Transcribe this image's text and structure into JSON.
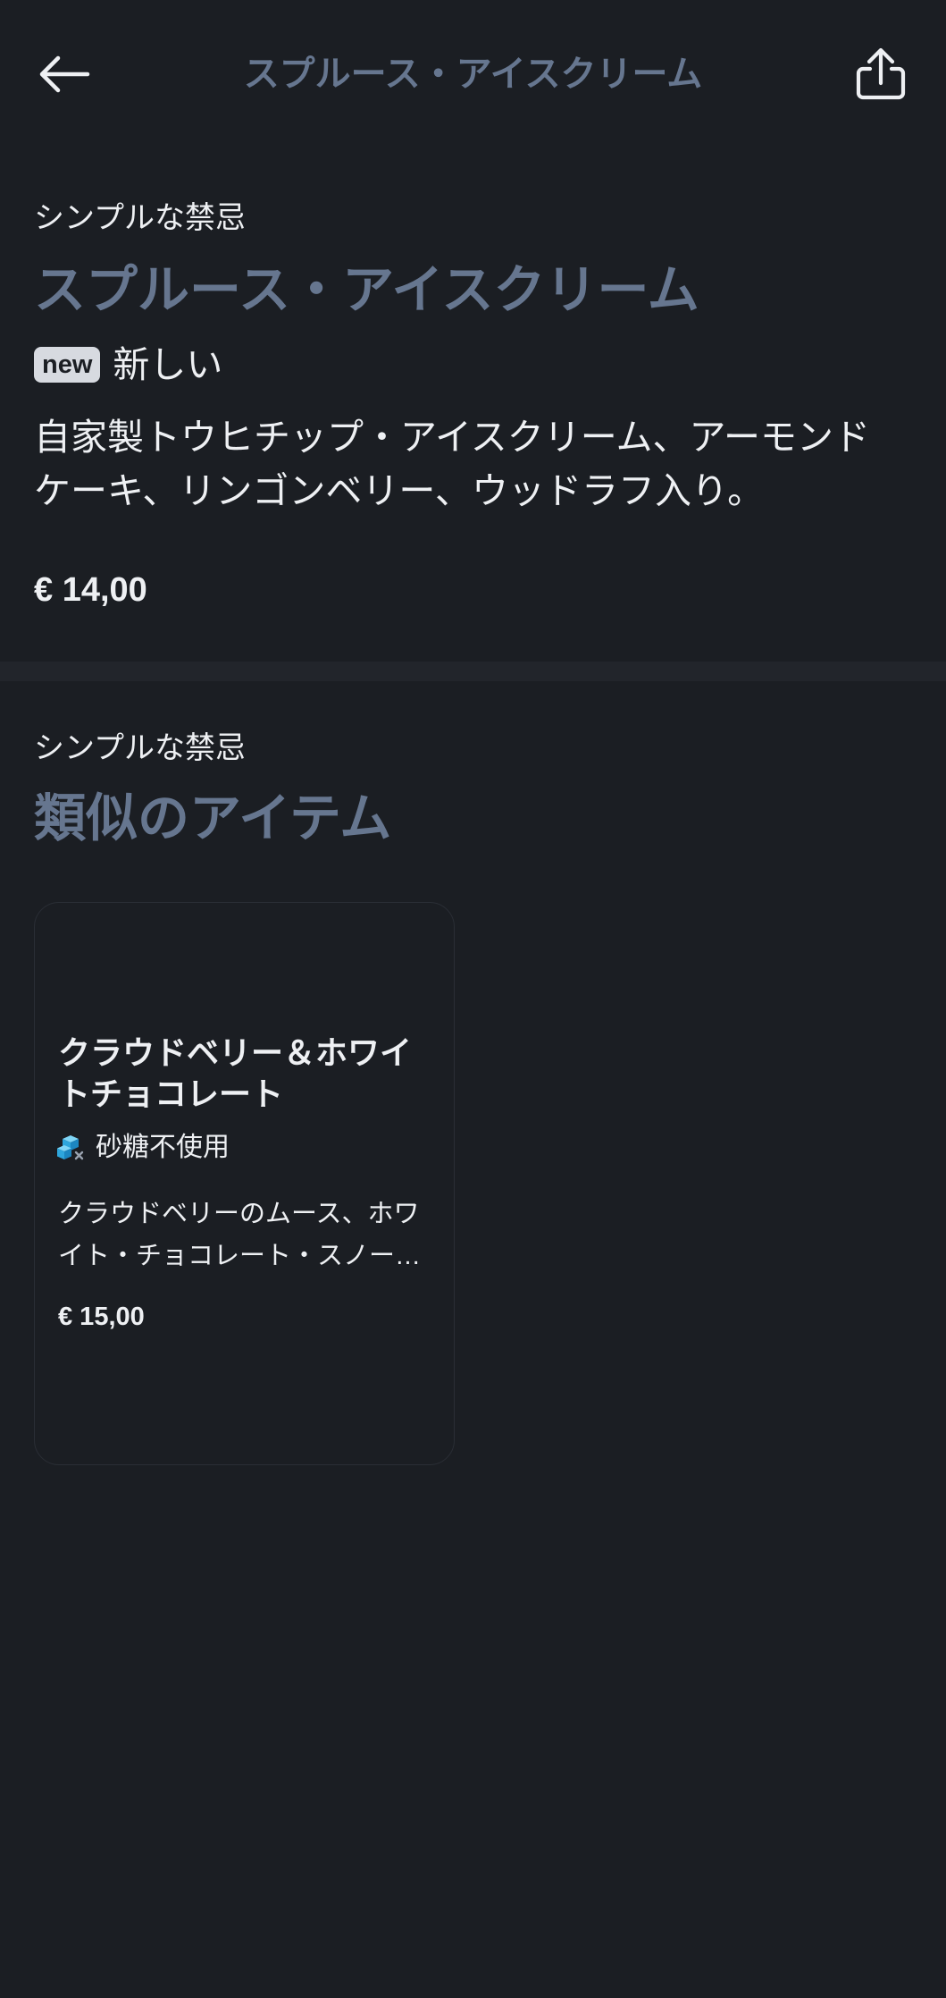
{
  "colors": {
    "background": "#1b1e23",
    "divider": "#22252b",
    "text": "#eef0f3",
    "accent_title": "#66768f",
    "badge_bg": "#d7dae0",
    "badge_text": "#1b1e23",
    "card_border": "#2a2e35",
    "sugar_free_icon": "#3db4e6"
  },
  "header": {
    "title": "スプルース・アイスクリーム",
    "back_icon": "back-arrow-icon",
    "share_icon": "share-icon"
  },
  "item": {
    "category": "シンプルな禁忌",
    "name": "スプルース・アイスクリーム",
    "badge": "new",
    "badge_label": "新しい",
    "description": "自家製トウヒチップ・アイスクリーム、アーモンドケーキ、リンゴンベリー、ウッドラフ入り。",
    "price": "€ 14,00"
  },
  "similar": {
    "category": "シンプルな禁忌",
    "title": "類似のアイテム",
    "items": [
      {
        "name": "クラウドベリー＆ホワイトチョコレート",
        "tag": "砂糖不使用",
        "tag_icon": "sugar-free-icon",
        "description": "クラウドベリーのムース、ホワイト・チョコレート・スノー…",
        "price": "€ 15,00"
      }
    ]
  }
}
